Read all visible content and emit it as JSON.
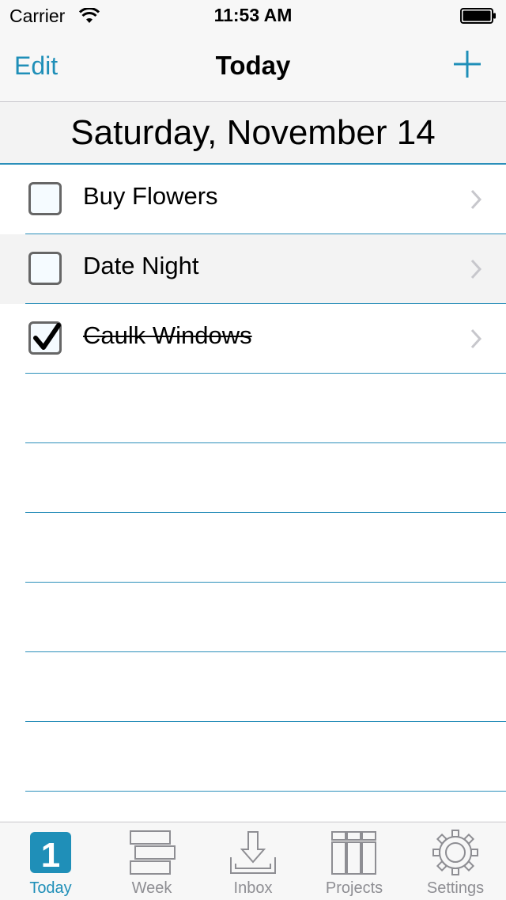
{
  "status_bar": {
    "carrier": "Carrier",
    "time": "11:53 AM"
  },
  "nav": {
    "edit_label": "Edit",
    "title": "Today",
    "add_icon": "plus-icon"
  },
  "date_header": "Saturday, November 14",
  "tasks": [
    {
      "label": "Buy Flowers",
      "checked": false
    },
    {
      "label": "Date Night",
      "checked": false
    },
    {
      "label": "Caulk Windows",
      "checked": true
    }
  ],
  "tabs": [
    {
      "label": "Today",
      "badge": "1",
      "icon": "today-calendar-icon",
      "active": true
    },
    {
      "label": "Week",
      "icon": "week-icon",
      "active": false
    },
    {
      "label": "Inbox",
      "icon": "inbox-icon",
      "active": false
    },
    {
      "label": "Projects",
      "icon": "projects-icon",
      "active": false
    },
    {
      "label": "Settings",
      "icon": "gear-icon",
      "active": false
    }
  ],
  "colors": {
    "accent": "#1f8fb8",
    "divider": "#2b8fba",
    "inactive_tab": "#8e8e93"
  }
}
